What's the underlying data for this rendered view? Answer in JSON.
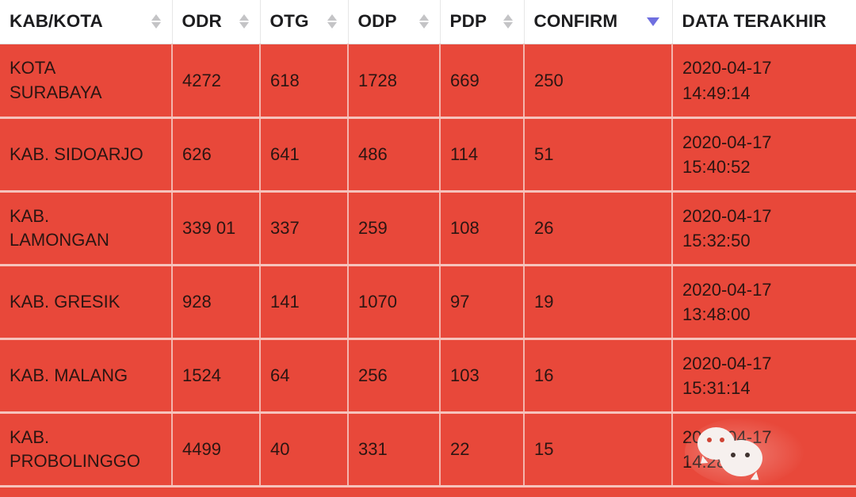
{
  "table": {
    "columns": [
      {
        "key": "kab",
        "label": "KAB/KOTA",
        "sort": "none",
        "sort_icon": "sort-both-icon"
      },
      {
        "key": "odr",
        "label": "ODR",
        "sort": "none",
        "sort_icon": "sort-both-icon"
      },
      {
        "key": "otg",
        "label": "OTG",
        "sort": "none",
        "sort_icon": "sort-both-icon"
      },
      {
        "key": "odp",
        "label": "ODP",
        "sort": "none",
        "sort_icon": "sort-both-icon"
      },
      {
        "key": "pdp",
        "label": "PDP",
        "sort": "none",
        "sort_icon": "sort-both-icon"
      },
      {
        "key": "confirm",
        "label": "CONFIRM",
        "sort": "desc",
        "sort_icon": "sort-descending-icon"
      },
      {
        "key": "date",
        "label": "DATA TERAKHIR",
        "sort": "none",
        "sort_icon": "none"
      }
    ],
    "rows": [
      {
        "kab_line1": "KOTA",
        "kab_line2": "SURABAYA",
        "odr": "4272",
        "otg": "618",
        "odp": "1728",
        "pdp": "669",
        "confirm": "250",
        "date": "2020-04-17",
        "time": "14:49:14"
      },
      {
        "kab_line1": "KAB. SIDOARJO",
        "kab_line2": "",
        "odr": "626",
        "otg": "641",
        "odp": "486",
        "pdp": "114",
        "confirm": "51",
        "date": "2020-04-17",
        "time": "15:40:52"
      },
      {
        "kab_line1": "KAB.",
        "kab_line2": "LAMONGAN",
        "odr": "339 01",
        "otg": "337",
        "odp": "259",
        "pdp": "108",
        "confirm": "26",
        "date": "2020-04-17",
        "time": "15:32:50"
      },
      {
        "kab_line1": "KAB. GRESIK",
        "kab_line2": "",
        "odr": "928",
        "otg": "141",
        "odp": "1070",
        "pdp": "97",
        "confirm": "19",
        "date": "2020-04-17",
        "time": "13:48:00"
      },
      {
        "kab_line1": "KAB. MALANG",
        "kab_line2": "",
        "odr": "1524",
        "otg": "64",
        "odp": "256",
        "pdp": "103",
        "confirm": "16",
        "date": "2020-04-17",
        "time": "15:31:14"
      },
      {
        "kab_line1": "KAB.",
        "kab_line2": "PROBOLINGGO",
        "odr": "4499",
        "otg": "40",
        "odp": "331",
        "pdp": "22",
        "confirm": "15",
        "date": "2020-04-17",
        "time": "14:28:45"
      }
    ]
  },
  "watermark": {
    "name": "wechat-logo-watermark"
  },
  "colors": {
    "row_background": "#e8483a",
    "header_background": "#ffffff",
    "header_text": "#1d1d1f",
    "cell_text": "#2b1512",
    "grid_line": "#f6c3bc",
    "sort_active": "#6f6fe0",
    "sort_inactive": "#c4c4c6"
  }
}
